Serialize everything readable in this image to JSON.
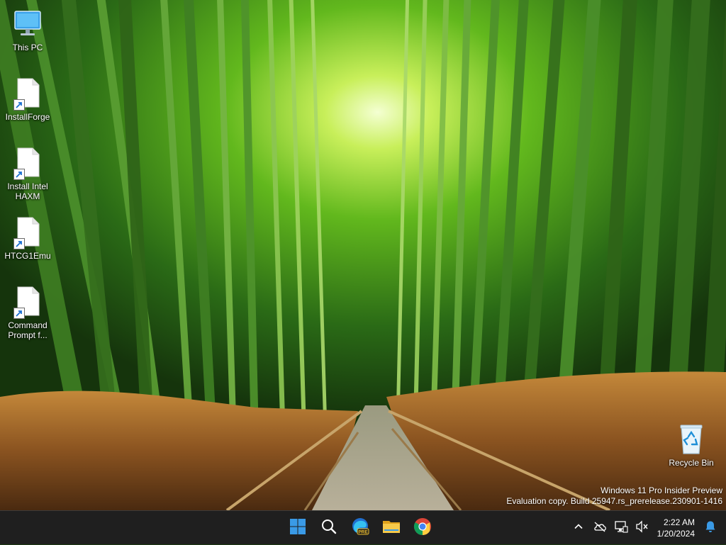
{
  "desktop": {
    "icons": [
      {
        "name": "this-pc",
        "label": "This PC",
        "icon": "monitor-icon",
        "shortcut": false
      },
      {
        "name": "installforge",
        "label": "InstallForge",
        "icon": "file-icon",
        "shortcut": true
      },
      {
        "name": "install-intel-haxm",
        "label": "Install Intel HAXM",
        "icon": "file-icon",
        "shortcut": true
      },
      {
        "name": "htcg1emu",
        "label": "HTCG1Emu",
        "icon": "file-icon",
        "shortcut": true
      },
      {
        "name": "command-prompt",
        "label": "Command Prompt f...",
        "icon": "file-icon",
        "shortcut": true
      }
    ],
    "recycle_bin": {
      "label": "Recycle Bin",
      "icon": "recycle-bin-icon"
    }
  },
  "watermark": {
    "line1": "Windows 11 Pro Insider Preview",
    "line2": "Evaluation copy. Build 25947.rs_prerelease.230901-1416"
  },
  "taskbar": {
    "pinned": [
      {
        "name": "start-button",
        "icon": "windows-start-icon"
      },
      {
        "name": "search-button",
        "icon": "search-icon"
      },
      {
        "name": "edge-preview-button",
        "icon": "edge-preview-icon",
        "badge": "PRE"
      },
      {
        "name": "file-explorer-button",
        "icon": "folder-icon"
      },
      {
        "name": "chrome-button",
        "icon": "chrome-icon"
      }
    ],
    "tray": {
      "icons": [
        "chevron-up-icon",
        "onedrive-icon",
        "network-icon",
        "volume-muted-icon"
      ],
      "time": "2:22 AM",
      "date": "1/20/2024",
      "notification_icon": "bell-icon"
    }
  },
  "colors": {
    "taskbar_bg": "#1f1f1f",
    "windows_blue": "#3a9ae6",
    "folder_yellow": "#f2c12e"
  }
}
